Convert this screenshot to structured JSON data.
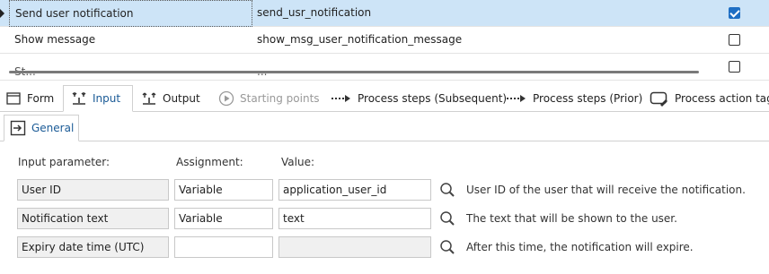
{
  "grid": {
    "rows": [
      {
        "name": "Send user notification",
        "id": "send_usr_notification",
        "checked": true
      },
      {
        "name": "Show message",
        "id": "show_msg_user_notification_message",
        "checked": false
      },
      {
        "name": "St...",
        "id": "...",
        "checked": false
      }
    ]
  },
  "tabs": [
    {
      "label": "Form",
      "icon": "form-icon"
    },
    {
      "label": "Input",
      "icon": "input-icon",
      "active": true
    },
    {
      "label": "Output",
      "icon": "output-icon"
    },
    {
      "label": "Starting points",
      "icon": "play-circle-icon",
      "disabled": true
    },
    {
      "label": "Process steps (Subsequent)",
      "icon": "dotted-arrow-icon"
    },
    {
      "label": "Process steps (Prior)",
      "icon": "dotted-arrow-icon"
    },
    {
      "label": "Process action tags",
      "icon": "tag-icon"
    }
  ],
  "subtab": {
    "label": "General",
    "icon": "enter-icon"
  },
  "form": {
    "headers": {
      "param": "Input parameter:",
      "assignment": "Assignment:",
      "value": "Value:"
    },
    "rows": [
      {
        "param": "User ID",
        "assignment": "Variable",
        "value": "application_user_id",
        "description": "User ID of the user that will receive the notification."
      },
      {
        "param": "Notification text",
        "assignment": "Variable",
        "value": "text",
        "description": "The text that will be shown to the user."
      },
      {
        "param": "Expiry date time (UTC)",
        "assignment": "",
        "value": "",
        "description": "After this time, the notification will expire."
      }
    ]
  },
  "colors": {
    "selection": "#cde4f7",
    "accent": "#1a5a96",
    "checkbox": "#1f6fc4"
  }
}
